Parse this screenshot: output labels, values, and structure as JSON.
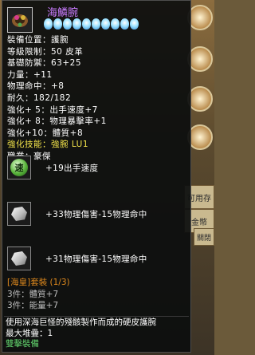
{
  "item": {
    "name": "海鱗腕",
    "stars": 10,
    "lines": [
      {
        "text": "裝備位置：護腕",
        "color": "white"
      },
      {
        "text": "等級限制：50  皮革",
        "color": "white"
      },
      {
        "text": "基礎防禦：63+25",
        "color": "white"
      },
      {
        "text": "力量：+11",
        "color": "white"
      },
      {
        "text": "物理命中：+8",
        "color": "white"
      },
      {
        "text": "耐久：182/182",
        "color": "white"
      },
      {
        "text": "強化+ 5：出手速度+7",
        "color": "white"
      },
      {
        "text": "強化+ 8：物理暴擊率+1",
        "color": "white"
      },
      {
        "text": "強化+10：體質+8",
        "color": "white"
      },
      {
        "text": "強化技能：強腕  LU1",
        "color": "yellow"
      },
      {
        "text": "職業：豪傑",
        "color": "white"
      }
    ]
  },
  "sockets": [
    {
      "icon": "speed-gem-icon",
      "gem_label": "速",
      "text": "+19出手速度"
    },
    {
      "icon": "stone-icon",
      "text": "+33物理傷害-15物理命中"
    },
    {
      "icon": "stone-icon",
      "text": "+31物理傷害-15物理命中"
    }
  ],
  "set": {
    "title": "[海皇]套裝 (1/3)",
    "items": [
      "3件：體質+7",
      "3件：能量+7"
    ]
  },
  "description": {
    "line1": "使用深海巨怪的殘骸製作而成的硬皮護腕",
    "line2": "最大堆疊：1",
    "line3": "雙擊裝備"
  },
  "background": {
    "close_label": "關閉",
    "tab_labels": [
      "金幣",
      "可用存"
    ]
  }
}
